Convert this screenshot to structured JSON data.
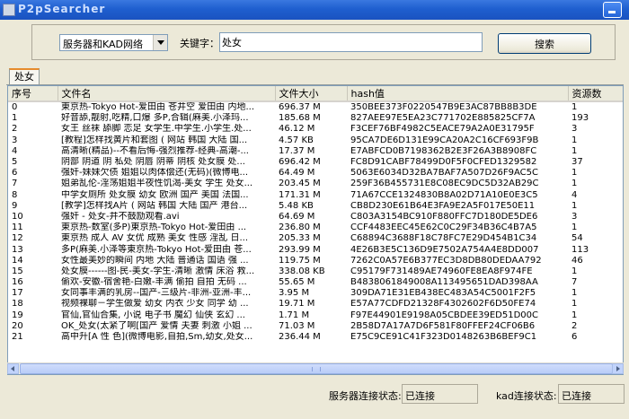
{
  "window": {
    "title": "P2pSearcher"
  },
  "search": {
    "mode_selected": "服务器和KAD网络",
    "keyword_label": "关键字：",
    "keyword_value": "处女",
    "button_label": "搜索"
  },
  "tabs": [
    {
      "label": "处女"
    }
  ],
  "table": {
    "columns": [
      "序号",
      "文件名",
      "文件大小",
      "hash值",
      "资源数"
    ],
    "rows": [
      [
        "0",
        "東京热-Tokyo Hot-爱田由 苍井空 爱田由 内地...",
        "696.37 M",
        "350BEE373F0220547B9E3AC87BB8B3DE",
        "1"
      ],
      [
        "1",
        "好音舔,靓射,吃精,口爆 多P,合辑(麻美.小泽玛...",
        "185.68 M",
        "827AEE97E5EA23C771702E885825CF7A",
        "193"
      ],
      [
        "2",
        "女王 丝袜 舔脚 恋足 女学生.中学生.小学生.处...",
        "46.12 M",
        "F3CEF76BF4982C5EACE79A2A0E31795F",
        "3"
      ],
      [
        "3",
        "[教程]怎样找黄片和套图 ( 网站 韩国 大陆 国...",
        "4.57 KB",
        "95CA7DE6D131E99CA20A2C16CF693F9B",
        "1"
      ],
      [
        "4",
        "高清晰(精品)--不看后悔-强烈推荐-经典-高潮-...",
        "17.37 M",
        "E7ABFCD0B7198362B2E3F26A3B8908FC",
        "1"
      ],
      [
        "5",
        "阴部 阴道 阴 私处 阴唇 阴蒂 阴核 处女膜 处...",
        "696.42 M",
        "FC8D91CABF78499D0F5F0CFED1329582",
        "37"
      ],
      [
        "6",
        "强奸-妹妹欠债 姐姐以肉体偿还(无码)(微博电...",
        "64.49 M",
        "5063E6034D32BA7BAF7A507D26F9AC5C",
        "1"
      ],
      [
        "7",
        "姐弟乱伦-淫荡姐姐半夜性饥渴-美女 学生 处女...",
        "203.45 M",
        "259F36B455731E8C08EC9DC5D32AB29C",
        "1"
      ],
      [
        "8",
        "中学女厕所 处女膜 幼女 欧洲 国产 美国 法国...",
        "171.31 M",
        "71A67CCE1324830B8A02D71A10E0E3C5",
        "4"
      ],
      [
        "9",
        "[教学]怎样找A片 ( 网站 韩国 大陆 国产 港台...",
        "5.48 KB",
        "CB8D230E61B64E3FA9E2A5F017E50E11",
        "1"
      ],
      [
        "10",
        "强奸 - 处女-并不鼓励观看.avi",
        "64.69 M",
        "C803A3154BC910F880FFC7D180DE5DE6",
        "3"
      ],
      [
        "11",
        "東京热-数室(多P)東京热-Tokyo Hot-爱田由 ...",
        "236.80 M",
        "CCF4483EEC45E62C0C29F34B36C4B7A5",
        "1"
      ],
      [
        "12",
        "東京热 成人 AV 女优 成熟 美女 性感 淫乱 日...",
        "205.33 M",
        "C68894C3688F18C78FC7E29D454B1C34",
        "54"
      ],
      [
        "13",
        "多P(麻美.小泽等東京热-Tokyo Hot-爱田由 苍...",
        "293.99 M",
        "4E26B3E5C136D9E7502A754A4E8DD007",
        "113"
      ],
      [
        "14",
        "女性最美妙的瞬间 内地 大陆 普通话 国语 强 ...",
        "119.75 M",
        "7262C0A57E6B377EC3D8DB80DEDAA792",
        "46"
      ],
      [
        "15",
        "处女膜------图-民-美女-学生-清晰 激情 床浴 救...",
        "338.08 KB",
        "C95179F731489AE74960FE8EA8F974FE",
        "1"
      ],
      [
        "16",
        "偷欢-安徽-宿舍艳-白嫩-丰满 偷拍 自拍 无码 ...",
        "55.65 M",
        "B4838061849008A113495651DAD398AA",
        "7"
      ],
      [
        "17",
        "女同事丰满的乳房--国产-三级片-非洲-亚洲-丰...",
        "3.95 M",
        "309DA71E31EB438EC483A54C5001F2F5",
        "1"
      ],
      [
        "18",
        "视频裸聊－学生做爱 幼女 内衣 少女 同学 幼 ...",
        "19.71 M",
        "E57A77CDFD21328F4302602F6D50FE74",
        "1"
      ],
      [
        "19",
        "官仙,官仙合集, 小说 电子书 魔幻 仙侠 玄幻 ...",
        "1.71 M",
        "F97E44901E9198A05CBDEE39ED51D00C",
        "1"
      ],
      [
        "20",
        "OK_处女(太紧了啊[国产 爱情 夫妻 刺激 小姐 ...",
        "71.03 M",
        "2B58D7A17A7D6F581F80FFEF24CF06B6",
        "2"
      ],
      [
        "21",
        "高中升[A 性 色](微博电影,自拍,Sm,幼女,处女...",
        "236.44 M",
        "E75C9CE91C41F323D0148263B6BEF9C1",
        "6"
      ]
    ]
  },
  "status": {
    "server_label": "服务器连接状态:",
    "server_value": "已连接",
    "kad_label": "kad连接状态:",
    "kad_value": "已连接"
  }
}
